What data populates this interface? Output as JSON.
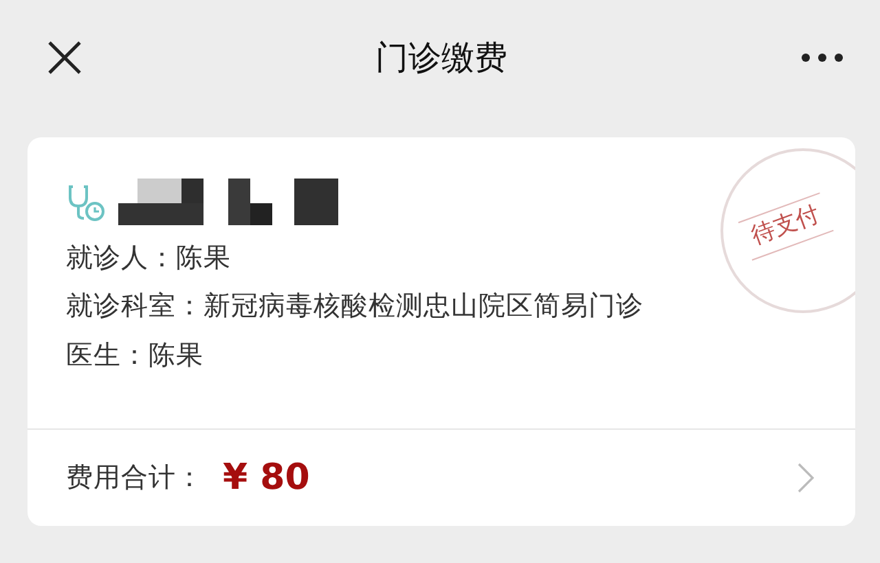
{
  "header": {
    "title": "门诊缴费"
  },
  "card": {
    "name_redacted": true,
    "stamp": "待支付",
    "lines": [
      "就诊人：陈果",
      "就诊科室：新冠病毒核酸检测忠山院区简易门诊",
      "医生：陈果"
    ],
    "total_label": "费用合计：",
    "total_amount": "¥ 80"
  }
}
